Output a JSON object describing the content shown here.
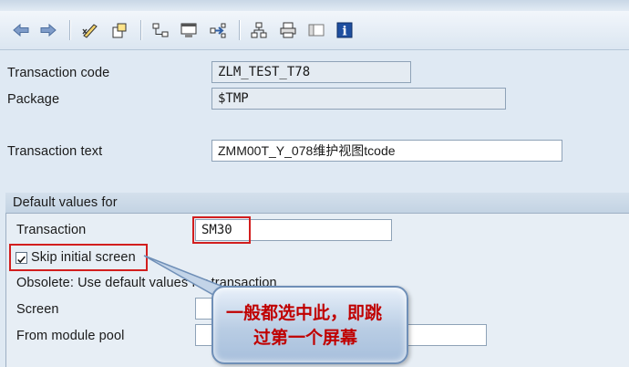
{
  "toolbar": {
    "buttons": [
      {
        "name": "back-arrow-icon"
      },
      {
        "name": "forward-arrow-icon"
      },
      {
        "name": "display-change-icon"
      },
      {
        "name": "other-object-icon"
      },
      {
        "name": "object-list-icon"
      },
      {
        "name": "where-used-icon"
      },
      {
        "name": "navigate-icon"
      },
      {
        "name": "hierarchy-icon"
      },
      {
        "name": "print-icon"
      },
      {
        "name": "layout-icon"
      },
      {
        "name": "info-icon"
      }
    ]
  },
  "form": {
    "transaction_code": {
      "label": "Transaction code",
      "value": "ZLM_TEST_T78"
    },
    "package": {
      "label": "Package",
      "value": "$TMP"
    },
    "transaction_text": {
      "label": "Transaction text",
      "value": "ZMM00T_Y_078维护视图tcode"
    }
  },
  "defaults": {
    "header": "Default values for",
    "transaction": {
      "label": "Transaction",
      "value": "SM30"
    },
    "skip_initial_screen": {
      "label": "Skip initial screen",
      "checked": true
    },
    "obsolete_note": "Obsolete: Use default values for transaction",
    "screen": {
      "label": "Screen",
      "value": ""
    },
    "module_pool": {
      "label": "From module pool",
      "value": ""
    }
  },
  "callout": {
    "line1": "一般都选中此，即跳",
    "line2": "过第一个屏幕"
  },
  "colors": {
    "annotation_red": "#d21e1e",
    "callout_text": "#c00000"
  }
}
